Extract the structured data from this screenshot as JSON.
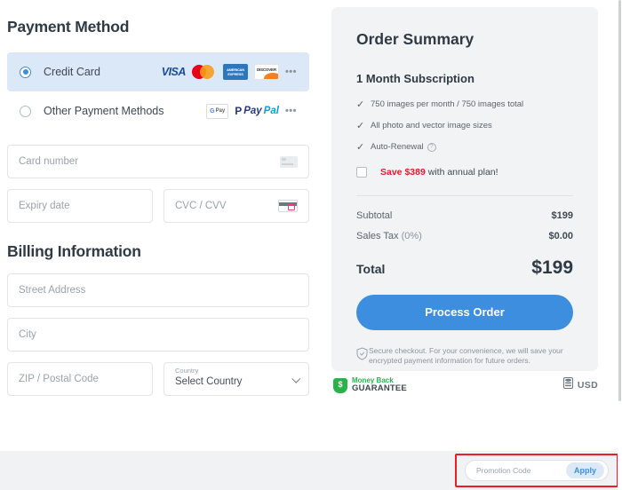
{
  "payment": {
    "title": "Payment Method",
    "methods": [
      {
        "label": "Credit Card",
        "selected": true,
        "logos": [
          "visa-logo",
          "mastercard-logo",
          "amex-logo",
          "discover-logo",
          "more-options-icon"
        ]
      },
      {
        "label": "Other Payment Methods",
        "selected": false,
        "logos": [
          "google-pay-logo",
          "paypal-logo",
          "more-options-icon"
        ]
      }
    ],
    "visa_text": "VISA",
    "amex_text": "AMERICAN EXPRESS",
    "discover_text": "DISCOVER",
    "gpay_g": "G",
    "gpay_pay": "Pay",
    "paypal_mark": "P",
    "paypal_pay": "Pay",
    "paypal_pal": "Pal",
    "ellipsis": "•••",
    "fields": {
      "card_number": "Card number",
      "expiry": "Expiry date",
      "cvc": "CVC / CVV"
    }
  },
  "billing": {
    "title": "Billing Information",
    "fields": {
      "street": "Street Address",
      "city": "City",
      "zip": "ZIP / Postal Code"
    },
    "country": {
      "label": "Country",
      "value": "Select Country"
    }
  },
  "summary": {
    "title": "Order Summary",
    "plan": "1 Month Subscription",
    "check_glyph": "✓",
    "features": [
      "750 images per month / 750 images total",
      "All photo and vector image sizes",
      "Auto-Renewal"
    ],
    "help_glyph": "?",
    "save": {
      "highlight": "Save $389",
      "rest": " with annual plan!",
      "checked": false
    },
    "prices": [
      {
        "label": "Subtotal",
        "sub": "",
        "value": "$199"
      },
      {
        "label": "Sales Tax ",
        "sub": "(0%)",
        "value": "$0.00"
      }
    ],
    "total_label": "Total",
    "total_value": "$199",
    "process_button": "Process Order",
    "secure_note": "Secure checkout. For your convenience, we will save your encrypted payment information for future orders."
  },
  "badges": {
    "money_back_line1": "Money Back",
    "money_back_line2": "GUARANTEE",
    "money_back_symbol": "$",
    "currency": "USD"
  },
  "promo": {
    "placeholder": "Promotion Code",
    "apply_label": "Apply"
  },
  "colors": {
    "accent": "#3d8ede",
    "danger": "#e8192c",
    "highlight_border": "#ee1c25",
    "success": "#27b34a",
    "panel_bg": "#f2f3f5",
    "selected_row": "#dbe8f8"
  }
}
